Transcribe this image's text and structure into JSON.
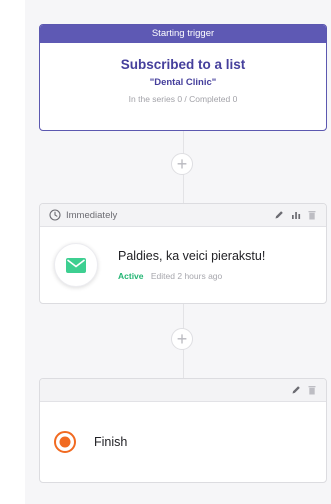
{
  "trigger": {
    "header": "Starting trigger",
    "title": "Subscribed to a list",
    "list_name": "\"Dental Clinic\"",
    "stats": "In the series 0 / Completed 0"
  },
  "add_step_symbol": "+",
  "email_step": {
    "timing": "Immediately",
    "timing_icon": "clock-icon",
    "action_icons": [
      "pencil-icon",
      "stats-icon",
      "trash-icon"
    ],
    "icon": "envelope-icon",
    "icon_color": "#3dcf91",
    "title": "Paldies, ka veici pierakstu!",
    "status": "Active",
    "status_color": "#22b573",
    "edited": "Edited 2 hours ago"
  },
  "finish_step": {
    "action_icons": [
      "pencil-icon",
      "trash-icon"
    ],
    "icon": "target-icon",
    "icon_color": "#f16a21",
    "label": "Finish"
  },
  "colors": {
    "trigger_accent": "#5e59b4",
    "canvas_bg": "#f6f6f8"
  }
}
